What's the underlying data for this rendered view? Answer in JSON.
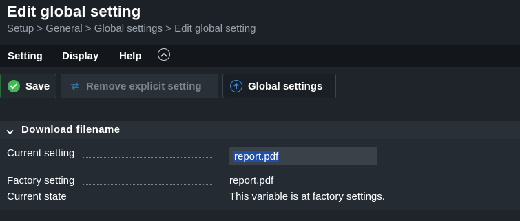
{
  "header": {
    "title": "Edit global setting",
    "breadcrumb": "Setup > General > Global settings > Edit global setting"
  },
  "menu": {
    "items": [
      "Setting",
      "Display",
      "Help"
    ]
  },
  "toolbar": {
    "save_label": "Save",
    "remove_label": "Remove explicit setting",
    "global_label": "Global settings"
  },
  "section": {
    "title": "Download filename",
    "rows": {
      "current_setting_label": "Current setting",
      "current_setting_value": "report.pdf",
      "factory_setting_label": "Factory setting",
      "factory_setting_value": "report.pdf",
      "current_state_label": "Current state",
      "current_state_value": "This variable is at factory settings."
    }
  },
  "colors": {
    "save_icon": "#3fb950",
    "global_icon": "#3b8fe0",
    "remove_icon": "#2f6f9c",
    "selection": "#1f4fa8"
  }
}
